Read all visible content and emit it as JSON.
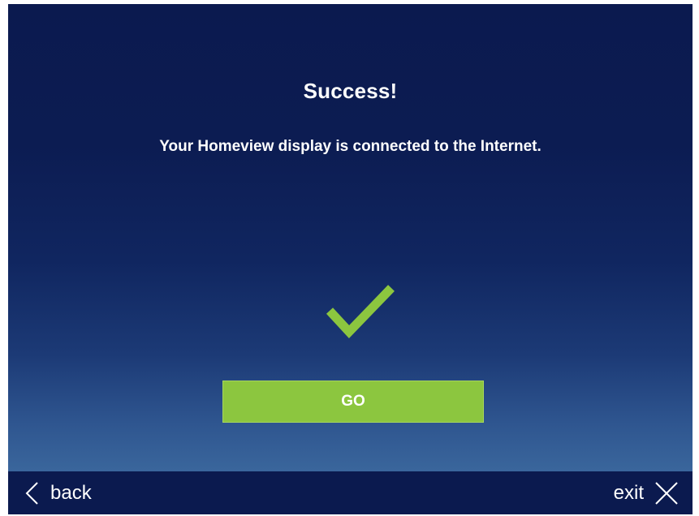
{
  "screen": {
    "title": "Success!",
    "message": "Your Homeview display is connected to the Internet.",
    "status_icon": "checkmark-icon",
    "go_label": "GO"
  },
  "footer": {
    "back_label": "back",
    "back_icon": "chevron-left-icon",
    "exit_label": "exit",
    "exit_icon": "close-icon"
  },
  "colors": {
    "background_top": "#0b1a4f",
    "background_bottom": "#3a669c",
    "accent_green": "#8cc63f",
    "text": "#ffffff"
  }
}
